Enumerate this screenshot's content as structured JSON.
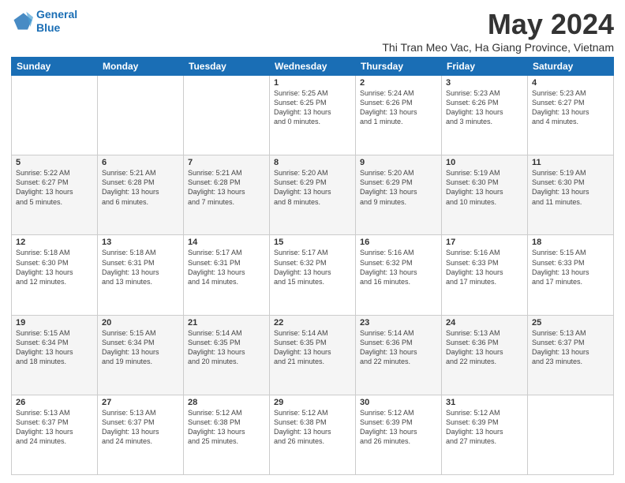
{
  "logo": {
    "line1": "General",
    "line2": "Blue"
  },
  "title": "May 2024",
  "location": "Thi Tran Meo Vac, Ha Giang Province, Vietnam",
  "days_of_week": [
    "Sunday",
    "Monday",
    "Tuesday",
    "Wednesday",
    "Thursday",
    "Friday",
    "Saturday"
  ],
  "weeks": [
    [
      {
        "day": "",
        "info": ""
      },
      {
        "day": "",
        "info": ""
      },
      {
        "day": "",
        "info": ""
      },
      {
        "day": "1",
        "info": "Sunrise: 5:25 AM\nSunset: 6:25 PM\nDaylight: 13 hours\nand 0 minutes."
      },
      {
        "day": "2",
        "info": "Sunrise: 5:24 AM\nSunset: 6:26 PM\nDaylight: 13 hours\nand 1 minute."
      },
      {
        "day": "3",
        "info": "Sunrise: 5:23 AM\nSunset: 6:26 PM\nDaylight: 13 hours\nand 3 minutes."
      },
      {
        "day": "4",
        "info": "Sunrise: 5:23 AM\nSunset: 6:27 PM\nDaylight: 13 hours\nand 4 minutes."
      }
    ],
    [
      {
        "day": "5",
        "info": "Sunrise: 5:22 AM\nSunset: 6:27 PM\nDaylight: 13 hours\nand 5 minutes."
      },
      {
        "day": "6",
        "info": "Sunrise: 5:21 AM\nSunset: 6:28 PM\nDaylight: 13 hours\nand 6 minutes."
      },
      {
        "day": "7",
        "info": "Sunrise: 5:21 AM\nSunset: 6:28 PM\nDaylight: 13 hours\nand 7 minutes."
      },
      {
        "day": "8",
        "info": "Sunrise: 5:20 AM\nSunset: 6:29 PM\nDaylight: 13 hours\nand 8 minutes."
      },
      {
        "day": "9",
        "info": "Sunrise: 5:20 AM\nSunset: 6:29 PM\nDaylight: 13 hours\nand 9 minutes."
      },
      {
        "day": "10",
        "info": "Sunrise: 5:19 AM\nSunset: 6:30 PM\nDaylight: 13 hours\nand 10 minutes."
      },
      {
        "day": "11",
        "info": "Sunrise: 5:19 AM\nSunset: 6:30 PM\nDaylight: 13 hours\nand 11 minutes."
      }
    ],
    [
      {
        "day": "12",
        "info": "Sunrise: 5:18 AM\nSunset: 6:30 PM\nDaylight: 13 hours\nand 12 minutes."
      },
      {
        "day": "13",
        "info": "Sunrise: 5:18 AM\nSunset: 6:31 PM\nDaylight: 13 hours\nand 13 minutes."
      },
      {
        "day": "14",
        "info": "Sunrise: 5:17 AM\nSunset: 6:31 PM\nDaylight: 13 hours\nand 14 minutes."
      },
      {
        "day": "15",
        "info": "Sunrise: 5:17 AM\nSunset: 6:32 PM\nDaylight: 13 hours\nand 15 minutes."
      },
      {
        "day": "16",
        "info": "Sunrise: 5:16 AM\nSunset: 6:32 PM\nDaylight: 13 hours\nand 16 minutes."
      },
      {
        "day": "17",
        "info": "Sunrise: 5:16 AM\nSunset: 6:33 PM\nDaylight: 13 hours\nand 17 minutes."
      },
      {
        "day": "18",
        "info": "Sunrise: 5:15 AM\nSunset: 6:33 PM\nDaylight: 13 hours\nand 17 minutes."
      }
    ],
    [
      {
        "day": "19",
        "info": "Sunrise: 5:15 AM\nSunset: 6:34 PM\nDaylight: 13 hours\nand 18 minutes."
      },
      {
        "day": "20",
        "info": "Sunrise: 5:15 AM\nSunset: 6:34 PM\nDaylight: 13 hours\nand 19 minutes."
      },
      {
        "day": "21",
        "info": "Sunrise: 5:14 AM\nSunset: 6:35 PM\nDaylight: 13 hours\nand 20 minutes."
      },
      {
        "day": "22",
        "info": "Sunrise: 5:14 AM\nSunset: 6:35 PM\nDaylight: 13 hours\nand 21 minutes."
      },
      {
        "day": "23",
        "info": "Sunrise: 5:14 AM\nSunset: 6:36 PM\nDaylight: 13 hours\nand 22 minutes."
      },
      {
        "day": "24",
        "info": "Sunrise: 5:13 AM\nSunset: 6:36 PM\nDaylight: 13 hours\nand 22 minutes."
      },
      {
        "day": "25",
        "info": "Sunrise: 5:13 AM\nSunset: 6:37 PM\nDaylight: 13 hours\nand 23 minutes."
      }
    ],
    [
      {
        "day": "26",
        "info": "Sunrise: 5:13 AM\nSunset: 6:37 PM\nDaylight: 13 hours\nand 24 minutes."
      },
      {
        "day": "27",
        "info": "Sunrise: 5:13 AM\nSunset: 6:37 PM\nDaylight: 13 hours\nand 24 minutes."
      },
      {
        "day": "28",
        "info": "Sunrise: 5:12 AM\nSunset: 6:38 PM\nDaylight: 13 hours\nand 25 minutes."
      },
      {
        "day": "29",
        "info": "Sunrise: 5:12 AM\nSunset: 6:38 PM\nDaylight: 13 hours\nand 26 minutes."
      },
      {
        "day": "30",
        "info": "Sunrise: 5:12 AM\nSunset: 6:39 PM\nDaylight: 13 hours\nand 26 minutes."
      },
      {
        "day": "31",
        "info": "Sunrise: 5:12 AM\nSunset: 6:39 PM\nDaylight: 13 hours\nand 27 minutes."
      },
      {
        "day": "",
        "info": ""
      }
    ]
  ]
}
